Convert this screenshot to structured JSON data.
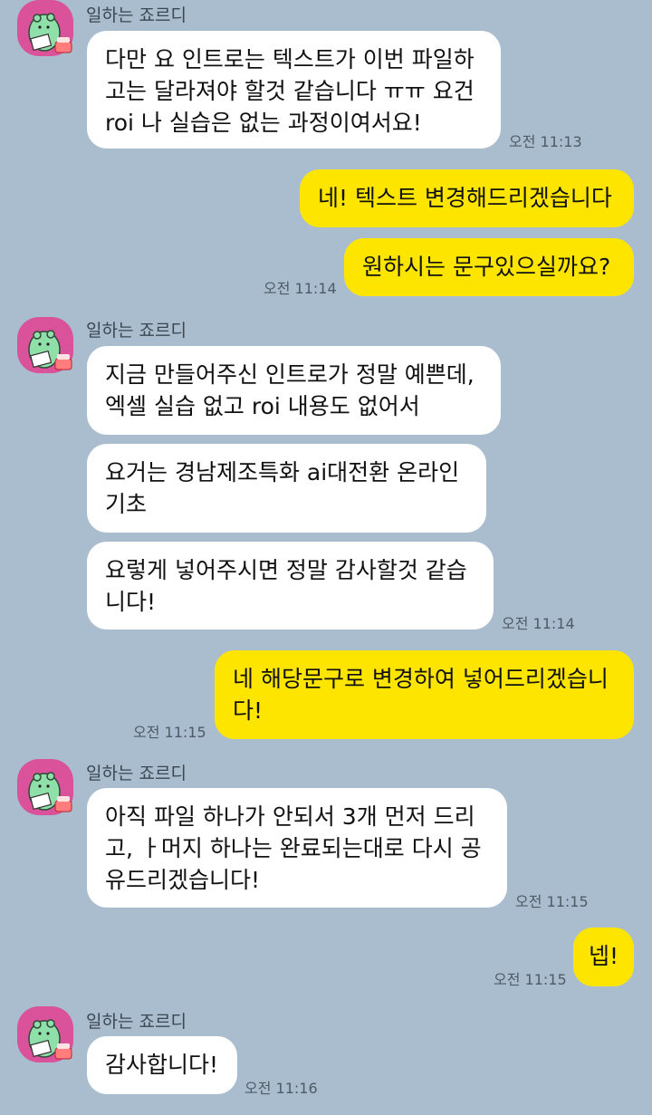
{
  "chat": {
    "groups": [
      {
        "sender": "일하는 죠르디",
        "messages": [
          {
            "lines": [
              "다만 요 인트로는 텍스트가 이번 파일하",
              "고는 달라져야 할것 같습니다 ㅠㅠ 요건",
              "roi 나 실습은 없는 과정이여서요!"
            ]
          }
        ],
        "time": "오전 11:13"
      },
      {
        "sender": "me",
        "messages": [
          {
            "lines": [
              "네! 텍스트 변경해드리겠습니다"
            ]
          },
          {
            "lines": [
              "원하시는 문구있으실까요?"
            ]
          }
        ],
        "time": "오전 11:14"
      },
      {
        "sender": "일하는 죠르디",
        "messages": [
          {
            "lines": [
              "지금 만들어주신 인트로가 정말 예쁜데,",
              "엑셀 실습 없고 roi 내용도 없어서"
            ]
          },
          {
            "lines": [
              "요거는 경남제조특화 ai대전환 온라인",
              "기초"
            ]
          },
          {
            "lines": [
              "요렇게 넣어주시면 정말 감사할것 같습",
              "니다!"
            ]
          }
        ],
        "time": "오전 11:14"
      },
      {
        "sender": "me",
        "messages": [
          {
            "lines": [
              "네 해당문구로 변경하여 넣어드리겠습니",
              "다!"
            ]
          }
        ],
        "time": "오전 11:15"
      },
      {
        "sender": "일하는 죠르디",
        "messages": [
          {
            "lines": [
              "아직 파일 하나가 안되서 3개 먼저 드리",
              "고, ㅏ머지 하나는 완료되는대로 다시 공",
              "유드리겠습니다!"
            ]
          }
        ],
        "time": "오전 11:15"
      },
      {
        "sender": "me",
        "messages": [
          {
            "lines": [
              "넵!"
            ]
          }
        ],
        "time": "오전 11:15"
      },
      {
        "sender": "일하는 죠르디",
        "messages": [
          {
            "lines": [
              "감사합니다!"
            ]
          }
        ],
        "time": "오전 11:16"
      }
    ]
  },
  "colors": {
    "background": "#a9bdce",
    "incoming_bubble": "#ffffff",
    "outgoing_bubble": "#fee500",
    "avatar_bg": "#d9529a"
  },
  "icons": {
    "avatar": "jordy-character-icon"
  }
}
